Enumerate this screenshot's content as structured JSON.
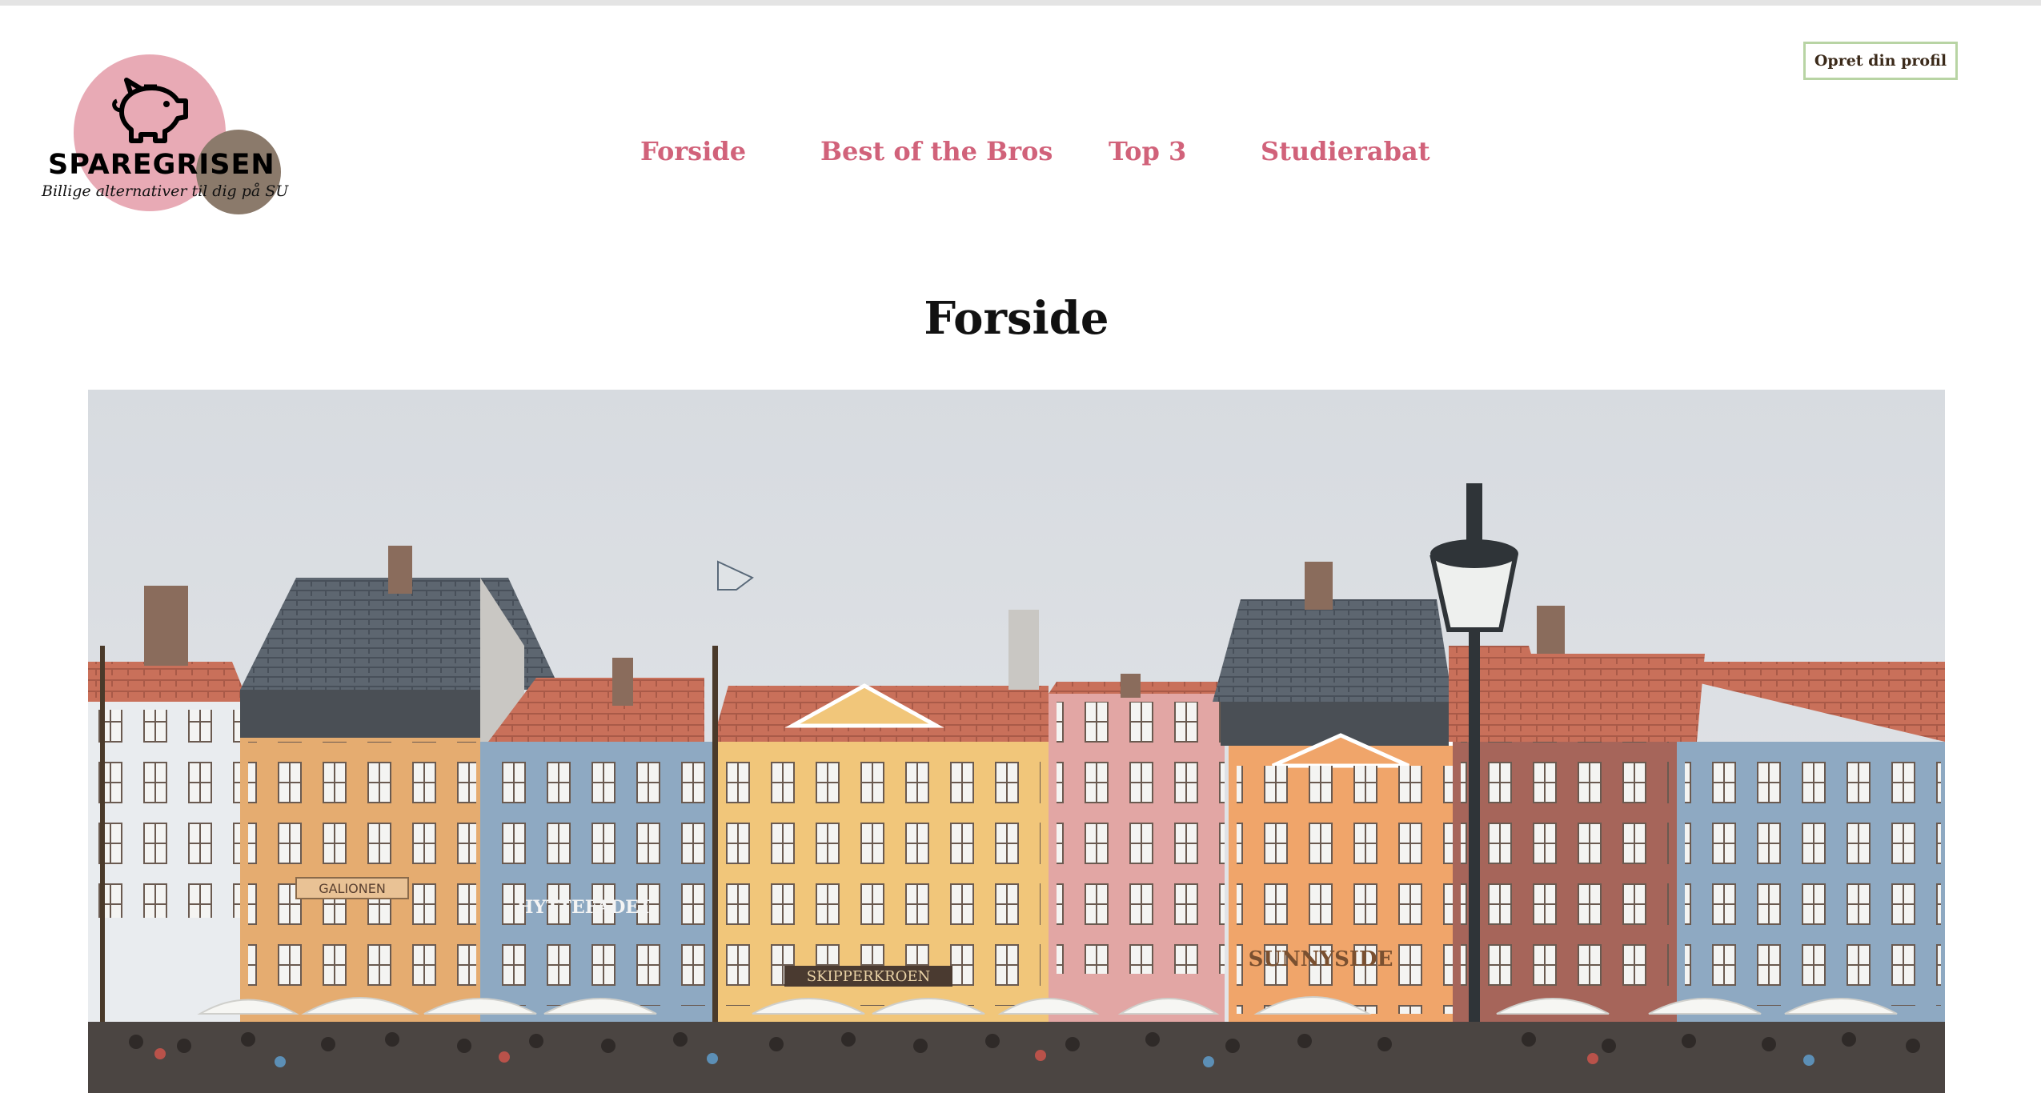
{
  "logo": {
    "brand": "SPAREGRISEN",
    "tagline": "Billige alternativer til dig på SU",
    "icon": "piggy-bank-icon"
  },
  "header": {
    "cta_label": "Opret din profil"
  },
  "nav": {
    "items": [
      {
        "label": "Forside"
      },
      {
        "label": "Best of the Bros"
      },
      {
        "label": "Top 3"
      },
      {
        "label": "Studierabat"
      }
    ]
  },
  "main": {
    "title": "Forside",
    "hero": {
      "signs": [
        "GALIONEN",
        "HYTTEFADET",
        "SKIPPERKROEN",
        "SUNNYSIDE"
      ]
    }
  },
  "colors": {
    "nav_link": "#d1627a",
    "cta_border": "#b8d4a4",
    "logo_pink": "#e8aab5",
    "logo_brown": "#8b7a6b"
  }
}
